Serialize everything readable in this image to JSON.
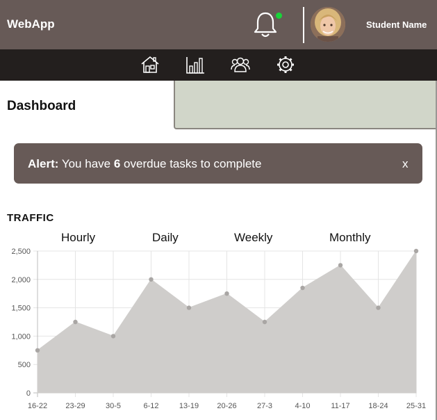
{
  "header": {
    "brand": "WebApp",
    "user_name": "Student Name",
    "notification_dot_color": "#19d439",
    "background_color": "#675a57"
  },
  "nav": {
    "background_color": "#231f1e",
    "items": [
      {
        "icon": "home-icon"
      },
      {
        "icon": "bar-chart-icon"
      },
      {
        "icon": "users-icon"
      },
      {
        "icon": "gear-icon"
      }
    ]
  },
  "page": {
    "title": "Dashboard"
  },
  "alert": {
    "prefix": "Alert:",
    "text_before": "You have",
    "count": "6",
    "text_after": "overdue tasks to complete",
    "close": "x"
  },
  "traffic": {
    "title": "TRAFFIC",
    "tabs": [
      "Hourly",
      "Daily",
      "Weekly",
      "Monthly"
    ]
  },
  "chart_data": {
    "type": "area",
    "categories": [
      "16-22",
      "23-29",
      "30-5",
      "6-12",
      "13-19",
      "20-26",
      "27-3",
      "4-10",
      "11-17",
      "18-24",
      "25-31"
    ],
    "series": [
      {
        "values": [
          750,
          1250,
          1000,
          2000,
          1500,
          1750,
          1250,
          1850,
          2250,
          1500,
          2500
        ]
      }
    ],
    "yticks": [
      "0",
      "500",
      "1,000",
      "1,500",
      "2,000",
      "2,500"
    ],
    "ylim": [
      0,
      2500
    ],
    "grid": true,
    "fill_color": "#cfcdcb",
    "point_color": "#a9a6a4"
  }
}
